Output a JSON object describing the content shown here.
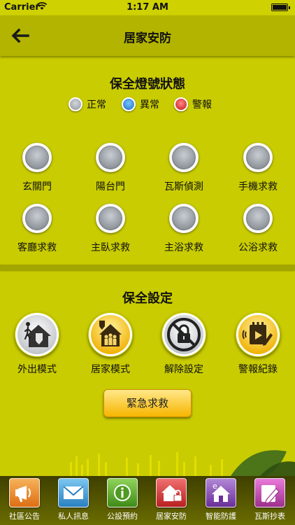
{
  "status_bar": {
    "carrier": "Carrier",
    "time": "1:17 AM"
  },
  "nav": {
    "title": "居家安防",
    "back_icon": "back-arrow-icon"
  },
  "status_section": {
    "title": "保全燈號狀態",
    "legend": [
      {
        "label": "正常",
        "color": "#a7acb2"
      },
      {
        "label": "異常",
        "color": "#2a8de0"
      },
      {
        "label": "警報",
        "color": "#e0262a"
      }
    ],
    "lights": [
      {
        "label": "玄關門",
        "state": "正常"
      },
      {
        "label": "陽台門",
        "state": "正常"
      },
      {
        "label": "瓦斯偵測",
        "state": "正常"
      },
      {
        "label": "手機求救",
        "state": "正常"
      },
      {
        "label": "客廳求救",
        "state": "正常"
      },
      {
        "label": "主臥求救",
        "state": "正常"
      },
      {
        "label": "主浴求救",
        "state": "正常"
      },
      {
        "label": "公浴求救",
        "state": "正常"
      }
    ]
  },
  "settings_section": {
    "title": "保全設定",
    "modes": [
      {
        "label": "外出模式",
        "icon": "away-mode-icon"
      },
      {
        "label": "居家模式",
        "icon": "home-mode-icon"
      },
      {
        "label": "解除設定",
        "icon": "disarm-icon"
      },
      {
        "label": "警報紀錄",
        "icon": "alarm-log-icon"
      }
    ],
    "sos_label": "緊急求救"
  },
  "tab_bar": [
    {
      "label": "社區公告",
      "icon": "announcement-icon",
      "color": "#e8862a"
    },
    {
      "label": "私人訊息",
      "icon": "mail-icon",
      "color": "#3f9fd6"
    },
    {
      "label": "公設預約",
      "icon": "info-icon",
      "color": "#58a62a"
    },
    {
      "label": "居家安防",
      "icon": "home-lock-icon",
      "color": "#d83a3a"
    },
    {
      "label": "智能防護",
      "icon": "smart-home-icon",
      "color": "#8a4fb0"
    },
    {
      "label": "瓦斯抄表",
      "icon": "meter-edit-icon",
      "color": "#c04bb0"
    }
  ]
}
